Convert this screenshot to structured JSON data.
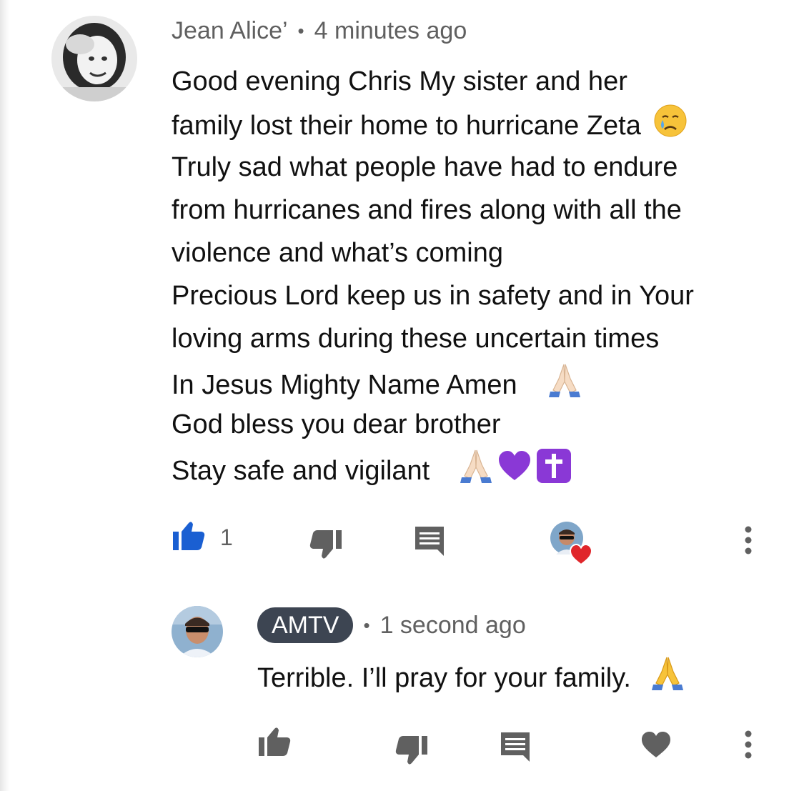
{
  "comment": {
    "author": "Jean Alice’",
    "time": "4 minutes ago",
    "lines": [
      "Good evening Chris   My sister and her",
      "family lost their home to hurricane Zeta",
      "Truly sad what people have had to endure",
      "from hurricanes and fires along with all the",
      "violence and what’s coming",
      "Precious Lord keep us in safety and in Your",
      "loving arms during these uncertain times",
      "In Jesus Mighty Name Amen",
      "God bless you dear brother",
      "Stay safe and vigilant"
    ],
    "likes": "1",
    "liked": true,
    "hearted_by_creator": true
  },
  "reply": {
    "author": "AMTV",
    "time": "1 second ago",
    "text": "Terrible. I’ll pray for your family."
  },
  "colors": {
    "like_active": "#1a5fd2",
    "icon_gray": "#606060",
    "heart_red": "#e0262b",
    "pill_bg": "#3d4552",
    "purple": "#8a38d6"
  },
  "icons": {
    "like": "thumbs-up-icon",
    "dislike": "thumbs-down-icon",
    "reply": "reply-comment-icon",
    "heart": "heart-icon",
    "more": "more-vertical-icon",
    "crying": "crying-face-emoji",
    "pray": "folded-hands-emoji",
    "purple_heart": "purple-heart-emoji",
    "cross": "latin-cross-emoji"
  }
}
